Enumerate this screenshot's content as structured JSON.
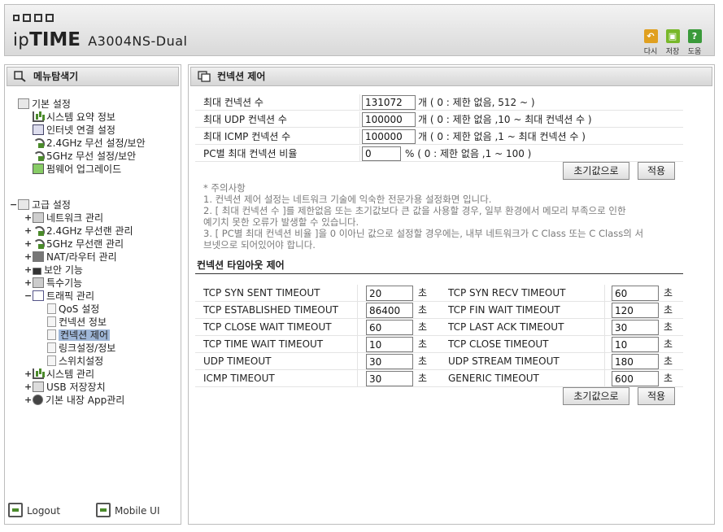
{
  "header": {
    "brand_prefix": "ip",
    "brand_bold": "TIME",
    "model": "A3004NS-Dual",
    "buttons": [
      {
        "label": "다시",
        "icon": "redo-icon",
        "color": "#e0a020"
      },
      {
        "label": "저장",
        "icon": "save-icon",
        "color": "#78b82a"
      },
      {
        "label": "도움",
        "icon": "help-icon",
        "color": "#3a9a3a"
      }
    ]
  },
  "sidebar": {
    "title": "메뉴탐색기",
    "groups": [
      {
        "label": "기본 설정",
        "items": [
          "시스템 요약 정보",
          "인터넷 연결 설정",
          "2.4GHz 무선 설정/보안",
          "5GHz 무선 설정/보안",
          "펌웨어 업그레이드"
        ]
      },
      {
        "label": "고급 설정",
        "items": [
          "네트워크 관리",
          "2.4GHz 무선랜 관리",
          "5GHz 무선랜 관리",
          "NAT/라우터 관리",
          "보안 기능",
          "특수기능",
          "트래픽 관리"
        ],
        "traffic_children": [
          "QoS 설정",
          "컨넥션 정보",
          "컨넥션 제어",
          "링크설정/정보",
          "스위치설정"
        ],
        "items_after": [
          "시스템 관리",
          "USB 저장장치",
          "기본 내장 App관리"
        ]
      }
    ],
    "footer": {
      "logout": "Logout",
      "mobile": "Mobile UI"
    }
  },
  "main": {
    "title": "컨넥션 제어",
    "limits": [
      {
        "label": "최대 컨넥션 수",
        "value": "131072",
        "hint": "개 ( 0 : 제한 없음, 512 ~ )"
      },
      {
        "label": "최대 UDP 컨넥션 수",
        "value": "100000",
        "hint": "개 ( 0 : 제한 없음 ,10 ~ 최대 컨넥션 수 )"
      },
      {
        "label": "최대 ICMP 컨넥션 수",
        "value": "100000",
        "hint": "개 ( 0 : 제한 없음 ,1 ~ 최대 컨넥션 수 )"
      },
      {
        "label": "PC별 최대 컨넥션 비율",
        "value": "0",
        "hint": "% ( 0 : 제한 없음 ,1 ~ 100 )"
      }
    ],
    "reset_label": "초기값으로",
    "apply_label": "적용",
    "notes": [
      "* 주의사항",
      "1. 컨넥션 제어 설정는 네트워크 기술에 익숙한 전문가용 설정화면 입니다.",
      "2. [ 최대 컨넥션 수 ]를 제한없음 또는 초기값보다 큰 값을 사용할 경우, 일부 환경에서 메모리 부족으로 인한",
      "예기치 못한 오류가 발생할 수 있습니다.",
      "3. [ PC별 최대 컨넥션 비율 ]을 0 이아닌 값으로 설정할 경우에는, 내부 네트워크가 C Class 또는 C Class의 서",
      "브넷으로 되어있어야 합니다."
    ],
    "timeout_title": "컨넥션 타임아웃 제어",
    "unit": "초",
    "timeouts": [
      {
        "l1": "TCP SYN SENT TIMEOUT",
        "v1": "20",
        "l2": "TCP SYN RECV TIMEOUT",
        "v2": "60"
      },
      {
        "l1": "TCP ESTABLISHED TIMEOUT",
        "v1": "86400",
        "l2": "TCP FIN WAIT TIMEOUT",
        "v2": "120"
      },
      {
        "l1": "TCP CLOSE WAIT TIMEOUT",
        "v1": "60",
        "l2": "TCP LAST ACK TIMEOUT",
        "v2": "30"
      },
      {
        "l1": "TCP TIME WAIT TIMEOUT",
        "v1": "10",
        "l2": "TCP CLOSE TIMEOUT",
        "v2": "10"
      },
      {
        "l1": "UDP TIMEOUT",
        "v1": "30",
        "l2": "UDP STREAM TIMEOUT",
        "v2": "180"
      },
      {
        "l1": "ICMP TIMEOUT",
        "v1": "30",
        "l2": "GENERIC TIMEOUT",
        "v2": "600"
      }
    ]
  }
}
